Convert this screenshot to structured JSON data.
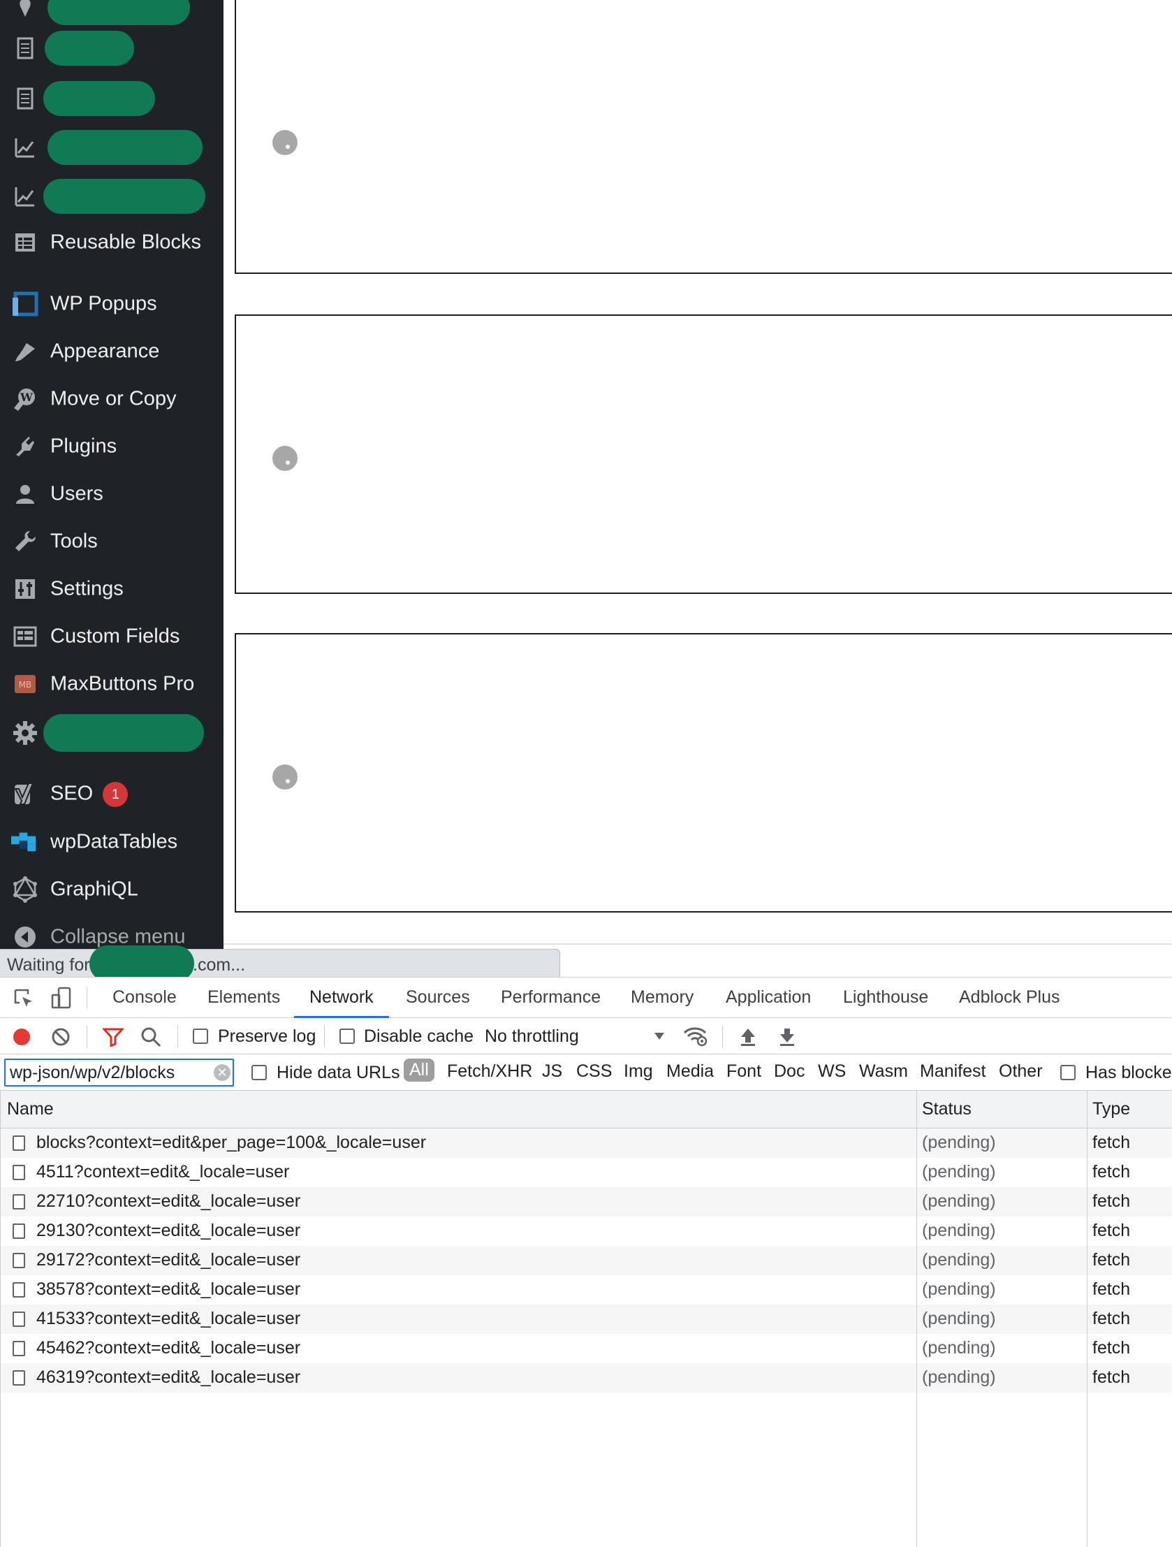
{
  "sidebar": {
    "items": [
      {
        "label": "",
        "icon": "pin-icon",
        "redacted": true
      },
      {
        "label": "",
        "icon": "page-icon",
        "redacted": true
      },
      {
        "label": "",
        "icon": "page-icon",
        "redacted": true
      },
      {
        "label": "",
        "icon": "chart-icon",
        "redacted": true
      },
      {
        "label": "",
        "icon": "chart-icon",
        "redacted": true
      },
      {
        "label": "Reusable Blocks",
        "icon": "table-icon"
      },
      {
        "label": "WP Popups",
        "icon": "popup-icon"
      },
      {
        "label": "Appearance",
        "icon": "brush-icon"
      },
      {
        "label": "Move or Copy",
        "icon": "copy-icon"
      },
      {
        "label": "Plugins",
        "icon": "plugin-icon"
      },
      {
        "label": "Users",
        "icon": "user-icon"
      },
      {
        "label": "Tools",
        "icon": "wrench-icon"
      },
      {
        "label": "Settings",
        "icon": "settings-icon"
      },
      {
        "label": "Custom Fields",
        "icon": "fields-icon"
      },
      {
        "label": "MaxButtons Pro",
        "icon": "maxbuttons-icon"
      },
      {
        "label": "",
        "icon": "gear-icon",
        "redacted": true
      },
      {
        "label": "SEO",
        "icon": "yoast-icon",
        "badge": "1"
      },
      {
        "label": "wpDataTables",
        "icon": "datatables-icon"
      },
      {
        "label": "GraphiQL",
        "icon": "graphql-icon"
      },
      {
        "label": "Collapse menu",
        "icon": "collapse-icon"
      }
    ]
  },
  "status_bar": {
    "text_before": "Waiting for",
    "text_after": ".com..."
  },
  "devtools": {
    "tabs": [
      "Console",
      "Elements",
      "Network",
      "Sources",
      "Performance",
      "Memory",
      "Application",
      "Lighthouse",
      "Adblock Plus"
    ],
    "active_tab": "Network",
    "toolbar": {
      "preserve_log": "Preserve log",
      "disable_cache": "Disable cache",
      "throttling": "No throttling"
    },
    "filter": {
      "value": "wp-json/wp/v2/blocks",
      "hide_data_urls": "Hide data URLs",
      "types": [
        "All",
        "Fetch/XHR",
        "JS",
        "CSS",
        "Img",
        "Media",
        "Font",
        "Doc",
        "WS",
        "Wasm",
        "Manifest",
        "Other"
      ],
      "has_blocked": "Has blocke"
    },
    "columns": [
      "Name",
      "Status",
      "Type"
    ],
    "requests": [
      {
        "name": "blocks?context=edit&per_page=100&_locale=user",
        "status": "(pending)",
        "type": "fetch"
      },
      {
        "name": "4511?context=edit&_locale=user",
        "status": "(pending)",
        "type": "fetch"
      },
      {
        "name": "22710?context=edit&_locale=user",
        "status": "(pending)",
        "type": "fetch"
      },
      {
        "name": "29130?context=edit&_locale=user",
        "status": "(pending)",
        "type": "fetch"
      },
      {
        "name": "29172?context=edit&_locale=user",
        "status": "(pending)",
        "type": "fetch"
      },
      {
        "name": "38578?context=edit&_locale=user",
        "status": "(pending)",
        "type": "fetch"
      },
      {
        "name": "41533?context=edit&_locale=user",
        "status": "(pending)",
        "type": "fetch"
      },
      {
        "name": "45462?context=edit&_locale=user",
        "status": "(pending)",
        "type": "fetch"
      },
      {
        "name": "46319?context=edit&_locale=user",
        "status": "(pending)",
        "type": "fetch"
      }
    ]
  },
  "colors": {
    "sidebar_bg": "#1d2327",
    "redaction": "#107a55",
    "badge": "#d63638",
    "record": "#e53935",
    "filter_active": "#d93025",
    "accent": "#1a73e8"
  }
}
